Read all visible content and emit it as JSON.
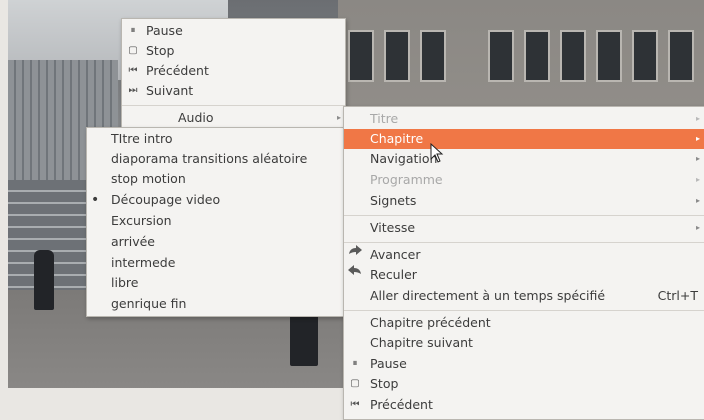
{
  "main_menu_top": {
    "items": [
      {
        "icon": "pause-icon",
        "glyph": "⏸",
        "label": "Pause"
      },
      {
        "icon": "stop-icon",
        "glyph": "▢",
        "label": "Stop"
      },
      {
        "icon": "previous-icon",
        "glyph": "⏮",
        "label": "Précédent"
      },
      {
        "icon": "next-icon",
        "glyph": "⏭",
        "label": "Suivant"
      }
    ],
    "audio_label": "Audio"
  },
  "chapter_list": {
    "items": [
      "TItre intro",
      "diaporama transitions aléatoire",
      "stop motion",
      "Découpage video",
      "Excursion",
      "arrivée",
      "intermede",
      "libre",
      "genrique fin"
    ],
    "selected_bullet": "•",
    "selected_index": 3
  },
  "navigation_menu": {
    "titre": "Titre",
    "chapitre": "Chapitre",
    "navigation": "Navigation",
    "programme": "Programme",
    "signets": "Signets",
    "vitesse": "Vitesse",
    "avancer": "Avancer",
    "reculer": "Reculer",
    "aller": "Aller directement à un temps spécifié",
    "aller_shortcut": "Ctrl+T",
    "chapitre_precedent": "Chapitre précédent",
    "chapitre_suivant": "Chapitre suivant",
    "pause": "Pause",
    "stop": "Stop",
    "precedent": "Précédent",
    "submenu_arrow": "▸"
  },
  "colors": {
    "highlight": "#f07746",
    "menu_bg": "#f4f3f1",
    "disabled_text": "#a8a8a8"
  }
}
